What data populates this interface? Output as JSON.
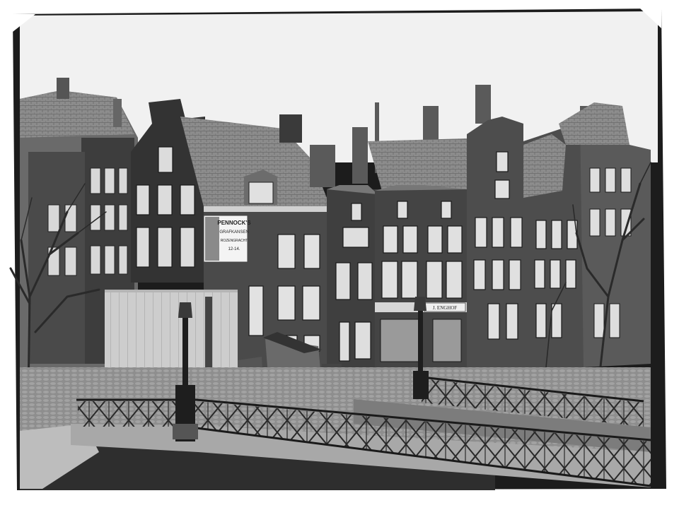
{
  "photo": {
    "type": "black-and-white glass plate negative scan",
    "tones": {
      "paper": "#ffffff",
      "sky": "#f2f2f2",
      "film_edge": "#1a1a1a",
      "dark_brick": "#3a3a3a",
      "mid_brick": "#5c5c5c",
      "roof_tile": "#8a8a8a",
      "street": "#9a9a9a",
      "water": "#2c2c2c",
      "fence_board": "#c9c9c9"
    }
  },
  "poster": {
    "line1": "PENNOCK'S",
    "line2": "GRAFKANSEN",
    "line3": "ROZENGRACHT",
    "line4": "12-14."
  },
  "shop_sign": {
    "text": "J. ENGHOF"
  }
}
